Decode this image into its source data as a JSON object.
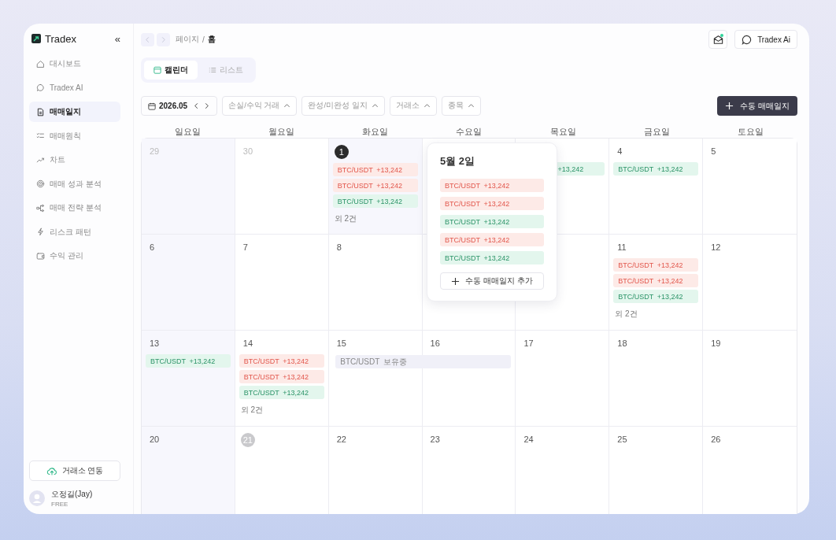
{
  "sidebar": {
    "logo": "Tradex",
    "collapse": "«",
    "items": [
      {
        "label": "대시보드",
        "selected": false
      },
      {
        "label": "Tradex AI",
        "selected": false
      },
      {
        "label": "매매일지",
        "selected": true
      },
      {
        "label": "매매원칙",
        "selected": false
      },
      {
        "label": "차트",
        "selected": false
      },
      {
        "label": "매매 성과 분석",
        "selected": false
      },
      {
        "label": "매매 전략 분석",
        "selected": false
      },
      {
        "label": "리스크 패턴",
        "selected": false
      },
      {
        "label": "수익 관리",
        "selected": false
      }
    ],
    "connect_button": "거래소 연동",
    "user": {
      "name": "오정길(Jay)",
      "plan": "FREE"
    }
  },
  "header": {
    "breadcrumb": [
      {
        "label": "페이지",
        "current": false
      },
      {
        "label": "홈",
        "current": true
      }
    ],
    "separator": "/",
    "mail_unread": true,
    "ai_button": "Tradex Ai"
  },
  "view_tabs": [
    {
      "label": "캘린더",
      "selected": true
    },
    {
      "label": "리스트",
      "selected": false
    }
  ],
  "filters": {
    "month": "2026.05",
    "dropdowns": [
      "손실/수익 거래",
      "완성/미완성 일지",
      "거래소",
      "종목"
    ],
    "add_button": "수동 매매일지"
  },
  "calendar": {
    "weekdays": [
      "일요일",
      "월요일",
      "화요일",
      "수요일",
      "목요일",
      "금요일",
      "토요일"
    ],
    "weeks": [
      [
        {
          "day": "29",
          "muted": true,
          "tinted": true
        },
        {
          "day": "30",
          "muted": true
        },
        {
          "day": "1",
          "circled": true,
          "today": true,
          "tinted": true,
          "entries": [
            {
              "pair": "BTC/USDT",
              "amount": "+13,242",
              "kind": "loss"
            },
            {
              "pair": "BTC/USDT",
              "amount": "+13,242",
              "kind": "loss"
            },
            {
              "pair": "BTC/USDT",
              "amount": "+13,242",
              "kind": "gain"
            }
          ],
          "more": "외 2건"
        },
        {
          "kind": "covered"
        },
        {
          "entries": [
            {
              "amount": "+13,242",
              "kind": "gain"
            }
          ]
        },
        {
          "day": "4",
          "entries": [
            {
              "pair": "BTC/USDT",
              "amount": "+13,242",
              "kind": "gain"
            }
          ]
        },
        {
          "day": "5"
        }
      ],
      [
        {
          "day": "6",
          "tinted": true
        },
        {
          "day": "7"
        },
        {
          "day": "8"
        },
        {
          "kind": "covered"
        },
        {
          "kind": "covered"
        },
        {
          "day": "11",
          "entries": [
            {
              "pair": "BTC/USDT",
              "amount": "+13,242",
              "kind": "loss"
            },
            {
              "pair": "BTC/USDT",
              "amount": "+13,242",
              "kind": "loss"
            },
            {
              "pair": "BTC/USDT",
              "amount": "+13,242",
              "kind": "gain"
            }
          ],
          "more": "외 2건"
        },
        {
          "day": "12"
        }
      ],
      [
        {
          "day": "13",
          "tinted": true,
          "entries": [
            {
              "pair": "BTC/USDT",
              "amount": "+13,242",
              "kind": "gain"
            }
          ]
        },
        {
          "day": "14",
          "entries": [
            {
              "pair": "BTC/USDT",
              "amount": "+13,242",
              "kind": "loss"
            },
            {
              "pair": "BTC/USDT",
              "amount": "+13,242",
              "kind": "loss"
            },
            {
              "pair": "BTC/USDT",
              "amount": "+13,242",
              "kind": "gain"
            }
          ],
          "more": "외 2건"
        },
        {
          "day": "15",
          "entries": [
            {
              "pair": "BTC/USDT",
              "amount": "보유중",
              "kind": "holding"
            }
          ]
        },
        {
          "day": "16"
        },
        {
          "day": "17"
        },
        {
          "day": "18"
        },
        {
          "day": "19"
        }
      ],
      [
        {
          "day": "20",
          "tinted": true
        },
        {
          "day": "21",
          "circled": true,
          "today": false
        },
        {
          "day": "22"
        },
        {
          "day": "23"
        },
        {
          "day": "24"
        },
        {
          "day": "25"
        },
        {
          "day": "26"
        }
      ]
    ],
    "popover": {
      "title": "5월 2일",
      "entries": [
        {
          "pair": "BTC/USDT",
          "amount": "+13,242",
          "kind": "loss"
        },
        {
          "pair": "BTC/USDT",
          "amount": "+13,242",
          "kind": "loss"
        },
        {
          "pair": "BTC/USDT",
          "amount": "+13,242",
          "kind": "gain"
        },
        {
          "pair": "BTC/USDT",
          "amount": "+13,242",
          "kind": "loss"
        },
        {
          "pair": "BTC/USDT",
          "amount": "+13,242",
          "kind": "gain"
        }
      ],
      "add_button": "수동 매매일지 추가"
    }
  }
}
